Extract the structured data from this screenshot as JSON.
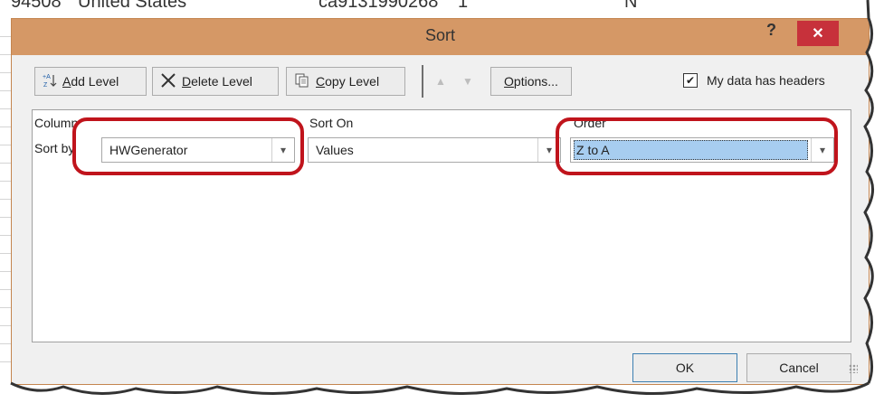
{
  "background": {
    "row_text": [
      "94508",
      "United States",
      "ca9131990268",
      "1",
      "N"
    ]
  },
  "dialog": {
    "title": "Sort",
    "help_label": "?",
    "close_label": "✕",
    "toolbar": {
      "add_level": "Add Level",
      "add_level_key": "A",
      "delete_level": "Delete Level",
      "delete_level_key": "D",
      "copy_level": "Copy Level",
      "copy_level_key": "C",
      "options": "Options...",
      "options_key": "O",
      "my_data_has_headers": "My data has headers",
      "headers_checked": true
    },
    "columns": {
      "column": "Column",
      "sort_on": "Sort On",
      "order": "Order"
    },
    "row": {
      "label": "Sort by",
      "column_value": "HWGenerator",
      "sort_on_value": "Values",
      "order_value": "Z to A"
    },
    "buttons": {
      "ok": "OK",
      "cancel": "Cancel"
    },
    "colors": {
      "titlebar": "#d59866",
      "close": "#c7313b",
      "highlight": "#c0141c",
      "selection": "#a7cdf0"
    }
  }
}
